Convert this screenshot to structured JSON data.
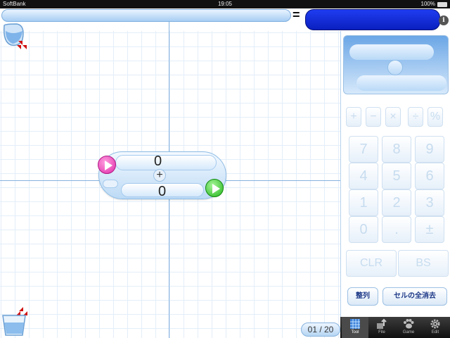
{
  "status_bar": {
    "carrier": "SoftBank",
    "time": "19:05",
    "battery": "100%"
  },
  "formula": {
    "equals": "=",
    "info": "i"
  },
  "expression": {
    "top_operand": "0",
    "operator": "+",
    "bottom_operand": "0"
  },
  "page_indicator": "01 / 20",
  "keypad": {
    "operators": [
      "+",
      "−",
      "×",
      "÷",
      "%"
    ],
    "digits": [
      "7",
      "8",
      "9",
      "4",
      "5",
      "6",
      "1",
      "2",
      "3",
      "0",
      ".",
      "±"
    ],
    "clr": "CLR",
    "bs": "BS"
  },
  "buttons": {
    "sort": "整列",
    "clear_all": "セルの全消去"
  },
  "tabs": [
    {
      "label": "Tool",
      "icon": "tool-grid-icon"
    },
    {
      "label": "File",
      "icon": "file-icon"
    },
    {
      "label": "Game",
      "icon": "game-paw-icon"
    },
    {
      "label": "Edit",
      "icon": "edit-gear-icon"
    }
  ],
  "colors": {
    "grid": "#b7d3ef",
    "formula_result": "#1f3df0",
    "play_left": "#e02aa8",
    "play_right": "#22b31a"
  }
}
